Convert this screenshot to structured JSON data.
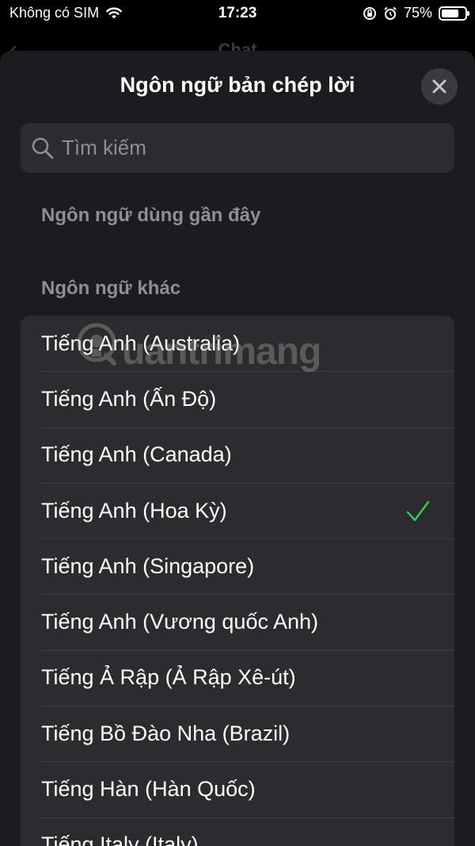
{
  "status_bar": {
    "carrier": "Không có SIM",
    "time": "17:23",
    "battery_percent": "75%",
    "battery_level": 0.75
  },
  "background_screen": {
    "back_icon": "chevron-left-icon",
    "title": "Chat"
  },
  "sheet": {
    "title": "Ngôn ngữ bản chép lời",
    "close_icon": "close-icon"
  },
  "search": {
    "placeholder": "Tìm kiếm",
    "value": ""
  },
  "sections": {
    "recent": "Ngôn ngữ dùng gần đây",
    "other": "Ngôn ngữ khác"
  },
  "languages": [
    {
      "label": "Tiếng Anh (Australia)",
      "selected": false
    },
    {
      "label": "Tiếng Anh (Ấn Độ)",
      "selected": false
    },
    {
      "label": "Tiếng Anh (Canada)",
      "selected": false
    },
    {
      "label": "Tiếng Anh (Hoa Kỳ)",
      "selected": true
    },
    {
      "label": "Tiếng Anh (Singapore)",
      "selected": false
    },
    {
      "label": "Tiếng Anh (Vương quốc Anh)",
      "selected": false
    },
    {
      "label": "Tiếng Ả Rập (Ả Rập Xê-út)",
      "selected": false
    },
    {
      "label": "Tiếng Bồ Đào Nha (Brazil)",
      "selected": false
    },
    {
      "label": "Tiếng Hàn (Hàn Quốc)",
      "selected": false
    },
    {
      "label": "Tiếng Italy (Italy)",
      "selected": false
    }
  ],
  "watermark": "uantrimang",
  "colors": {
    "sheet_bg": "#1c1c1e",
    "list_bg": "#2c2c2e",
    "check": "#30d158",
    "secondary_text": "#8e8e93"
  }
}
